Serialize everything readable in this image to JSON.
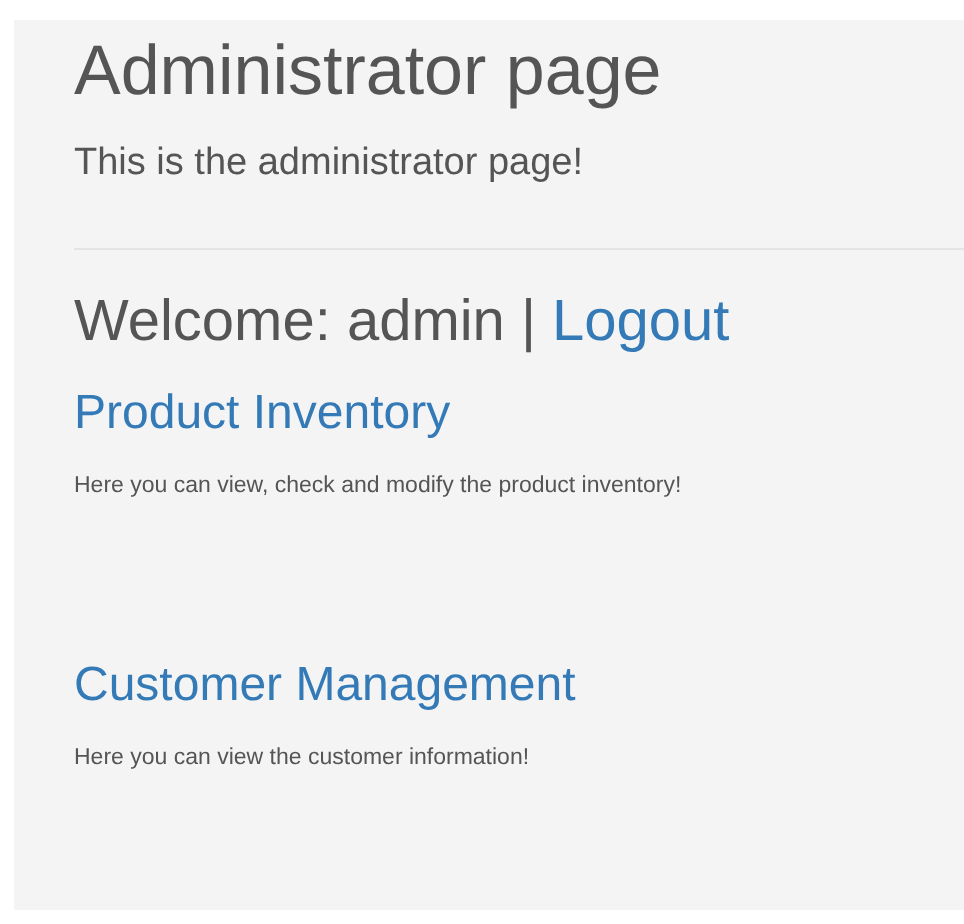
{
  "heading": "Administrator page",
  "subtitle": "This is the administrator page!",
  "welcome": {
    "text": "Welcome: admin |",
    "link": "Logout"
  },
  "sections": [
    {
      "title": "Product Inventory",
      "description": "Here you can view, check and modify the product inventory!"
    },
    {
      "title": "Customer Management",
      "description": "Here you can view the customer information!"
    }
  ]
}
